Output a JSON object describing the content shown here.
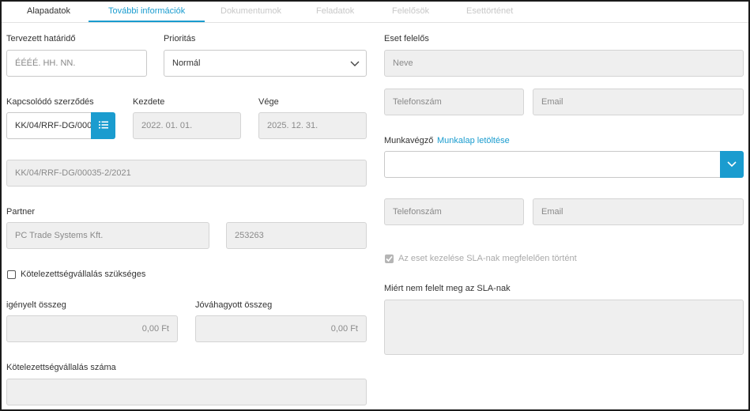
{
  "tabs": [
    {
      "label": "Alapadatok",
      "state": "enabled"
    },
    {
      "label": "További információk",
      "state": "active"
    },
    {
      "label": "Dokumentumok",
      "state": "disabled"
    },
    {
      "label": "Feladatok",
      "state": "disabled"
    },
    {
      "label": "Felelősök",
      "state": "disabled"
    },
    {
      "label": "Esettörténet",
      "state": "disabled"
    }
  ],
  "left": {
    "deadline": {
      "label": "Tervezett határidő",
      "placeholder": "ÉÉÉÉ. HH. NN."
    },
    "priority": {
      "label": "Prioritás",
      "value": "Normál",
      "icon": "chevron-down-icon"
    },
    "contract": {
      "label": "Kapcsolódó szerződés",
      "value": "KK/04/RRF-DG/000",
      "button_icon": "list-icon",
      "full_value": "KK/04/RRF-DG/00035-2/2021"
    },
    "start": {
      "label": "Kezdete",
      "value": "2022. 01. 01."
    },
    "end": {
      "label": "Vége",
      "value": "2025. 12. 31."
    },
    "partner": {
      "label": "Partner",
      "name": "PC Trade Systems Kft.",
      "code": "253263"
    },
    "commitment_checkbox": {
      "label": "Kötelezettségvállalás szükséges",
      "checked": false
    },
    "requested_amount": {
      "label": "igényelt összeg",
      "value": "0,00 Ft"
    },
    "approved_amount": {
      "label": "Jóváhagyott összeg",
      "value": "0,00 Ft"
    },
    "commitment_number": {
      "label": "Kötelezettségvállalás száma",
      "value": ""
    }
  },
  "right": {
    "case_owner": {
      "label": "Eset felelős",
      "name_placeholder": "Neve",
      "phone_placeholder": "Telefonszám",
      "email_placeholder": "Email"
    },
    "worker": {
      "label": "Munkavégző",
      "link": "Munkalap letöltése",
      "value": "",
      "phone_placeholder": "Telefonszám",
      "email_placeholder": "Email",
      "icon": "chevron-down-icon"
    },
    "sla_checkbox": {
      "label": "Az eset kezelése SLA-nak megfelelően történt",
      "checked": true
    },
    "sla_reason": {
      "label": "Miért nem felelt meg az SLA-nak",
      "value": ""
    }
  },
  "colors": {
    "accent": "#1a9ccf",
    "readonly_bg": "#efefef",
    "border": "#c9c9c9",
    "frame": "#1a1a1a"
  }
}
